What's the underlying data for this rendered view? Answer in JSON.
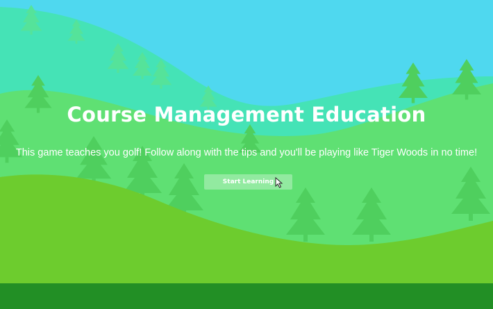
{
  "title": "Course Management Education",
  "description": "This game teaches you golf! Follow along with the tips and you'll be playing like Tiger Woods in no time!",
  "start_button_label": "Start Learning",
  "colors": {
    "sky": "#4fd8ef",
    "far_hill": "#45e3b6",
    "mid_hill": "#5fe073",
    "near_hill": "#6dcc2e",
    "ground": "#228f25",
    "tree_far": "#55e39a",
    "tree_mid": "#4fcf5e"
  },
  "icons": [
    "tree-icon",
    "mouse-cursor-icon"
  ]
}
